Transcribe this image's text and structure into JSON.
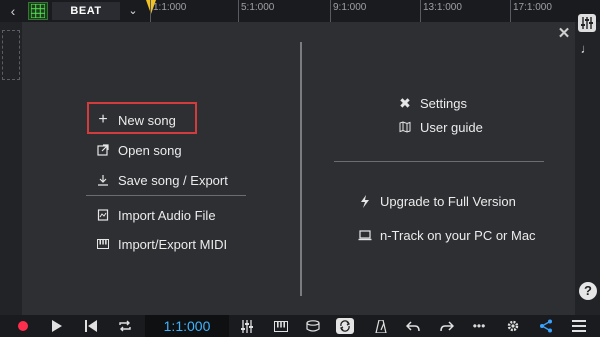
{
  "topbar": {
    "beat_label": "BEAT",
    "ruler_ticks": [
      "1:1:000",
      "5:1:000",
      "9:1:000",
      "13:1:000",
      "17:1:000"
    ],
    "accent_color": "#f2c122"
  },
  "menu_left": {
    "new_song": "New song",
    "open_song": "Open song",
    "save_song": "Save song / Export",
    "import_audio": "Import Audio File",
    "import_midi": "Import/Export MIDI"
  },
  "menu_right": {
    "settings": "Settings",
    "user_guide": "User guide",
    "upgrade": "Upgrade to Full Version",
    "pc_mac": "n-Track on your PC or Mac"
  },
  "transport": {
    "time": "1:1:000",
    "time_color": "#3eb4ff",
    "record_color": "#ff2e4d"
  },
  "highlight_color": "#d23c3c",
  "help_label": "?"
}
